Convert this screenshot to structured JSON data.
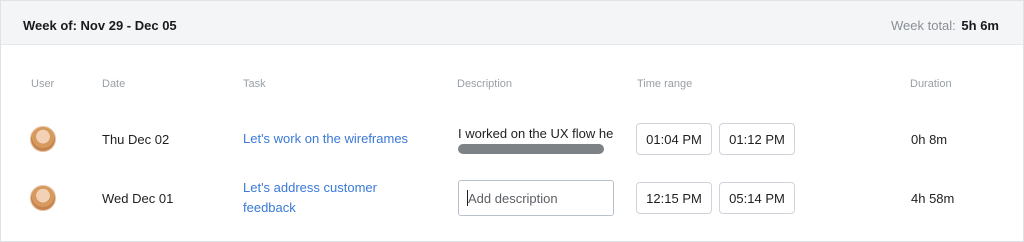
{
  "week": {
    "label": "Week of: Nov 29 - Dec 05",
    "total_label": "Week total:",
    "total_value": "5h 6m"
  },
  "columns": {
    "user": "User",
    "date": "Date",
    "task": "Task",
    "description": "Description",
    "time_range": "Time range",
    "duration": "Duration"
  },
  "entries": [
    {
      "avatar": "user-avatar",
      "date": "Thu Dec 02",
      "task_line1": "Let's work on the wireframes",
      "task_line2": "",
      "description": "I worked on the UX flow he",
      "description_placeholder": "",
      "start": "01:04 PM",
      "end": "01:12 PM",
      "duration": "0h 8m"
    },
    {
      "avatar": "user-avatar",
      "date": "Wed Dec 01",
      "task_line1": "Let's address customer",
      "task_line2": "feedback",
      "description": "",
      "description_placeholder": "Add description",
      "start": "12:15 PM",
      "end": "05:14 PM",
      "duration": "4h 58m"
    }
  ],
  "colors": {
    "link": "#3a79d8",
    "header_bg": "#f4f5f7",
    "muted": "#9aa0a6"
  }
}
